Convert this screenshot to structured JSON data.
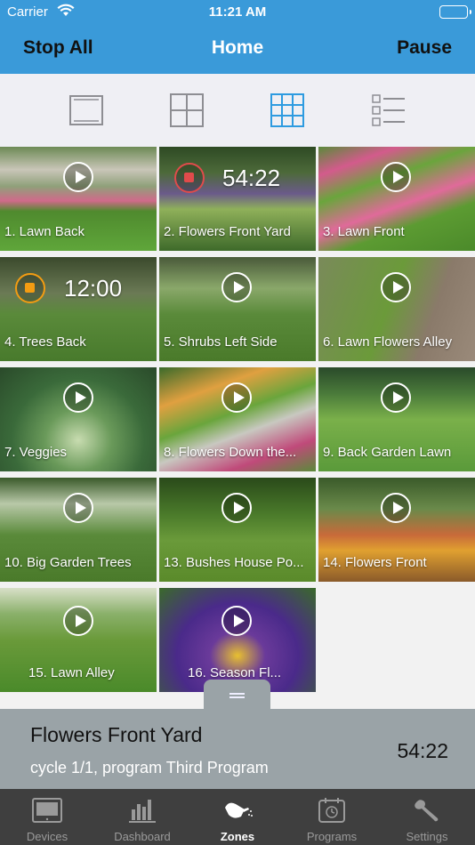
{
  "status_bar": {
    "carrier": "Carrier",
    "time": "11:21 AM"
  },
  "nav": {
    "left": "Stop All",
    "title": "Home",
    "right": "Pause"
  },
  "view_modes": [
    "single-view",
    "2x2-grid",
    "3x3-grid",
    "list-view"
  ],
  "view_mode_selected": "3x3-grid",
  "colors": {
    "accent": "#3a9ad9",
    "stop_red": "#e04b4b",
    "stop_orange": "#f39c12",
    "active_tab": "#ffffff",
    "inactive_tab": "#9a9a9a"
  },
  "zones": [
    {
      "label": "1. Lawn Back",
      "state": "idle"
    },
    {
      "label": "2. Flowers Front Yard",
      "state": "running",
      "timer": "54:22"
    },
    {
      "label": "3. Lawn Front",
      "state": "idle"
    },
    {
      "label": "4. Trees Back",
      "state": "queued",
      "timer": "12:00"
    },
    {
      "label": "5. Shrubs Left Side",
      "state": "idle"
    },
    {
      "label": "6. Lawn Flowers Alley",
      "state": "idle"
    },
    {
      "label": "7. Veggies",
      "state": "idle"
    },
    {
      "label": "8. Flowers Down the...",
      "state": "idle"
    },
    {
      "label": "9. Back Garden Lawn",
      "state": "idle"
    },
    {
      "label": "10. Big Garden Trees",
      "state": "idle"
    },
    {
      "label": "13. Bushes House Po...",
      "state": "idle"
    },
    {
      "label": "14. Flowers Front",
      "state": "idle"
    },
    {
      "label": "15. Lawn Alley",
      "state": "idle"
    },
    {
      "label": "16. Season Fl...",
      "state": "idle"
    }
  ],
  "panel": {
    "title": "Flowers Front Yard",
    "subtitle": "cycle 1/1, program Third Program",
    "remaining": "54:22"
  },
  "tabs": [
    {
      "label": "Devices",
      "icon": "device-icon"
    },
    {
      "label": "Dashboard",
      "icon": "bar-chart-icon"
    },
    {
      "label": "Zones",
      "icon": "watering-can-icon",
      "active": true
    },
    {
      "label": "Programs",
      "icon": "calendar-clock-icon"
    },
    {
      "label": "Settings",
      "icon": "wrench-icon"
    }
  ]
}
